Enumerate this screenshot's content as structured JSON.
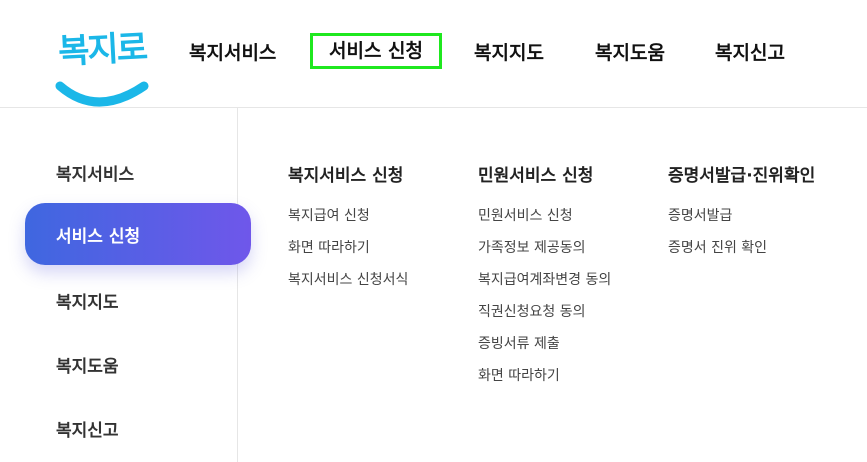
{
  "logo": {
    "text": "복지로"
  },
  "gnb": {
    "items": [
      {
        "label": "복지서비스"
      },
      {
        "label": "서비스 신청"
      },
      {
        "label": "복지지도"
      },
      {
        "label": "복지도움"
      },
      {
        "label": "복지신고"
      }
    ],
    "highlight_color": "#1fe81f"
  },
  "sidebar": {
    "items": [
      {
        "label": "복지서비스"
      },
      {
        "label": "서비스 신청"
      },
      {
        "label": "복지지도"
      },
      {
        "label": "복지도움"
      },
      {
        "label": "복지신고"
      }
    ],
    "active_gradient": [
      "#3f67e0",
      "#6f57ea"
    ]
  },
  "columns": [
    {
      "title": "복지서비스 신청",
      "links": [
        "복지급여 신청",
        "화면 따라하기",
        "복지서비스 신청서식"
      ]
    },
    {
      "title": "민원서비스 신청",
      "links": [
        "민원서비스 신청",
        "가족정보 제공동의",
        "복지급여계좌변경 동의",
        "직권신청요청 동의",
        "증빙서류 제출",
        "화면 따라하기"
      ]
    },
    {
      "title": "증명서발급·진위확인",
      "links": [
        "증명서발급",
        "증명서 진위 확인"
      ]
    }
  ]
}
